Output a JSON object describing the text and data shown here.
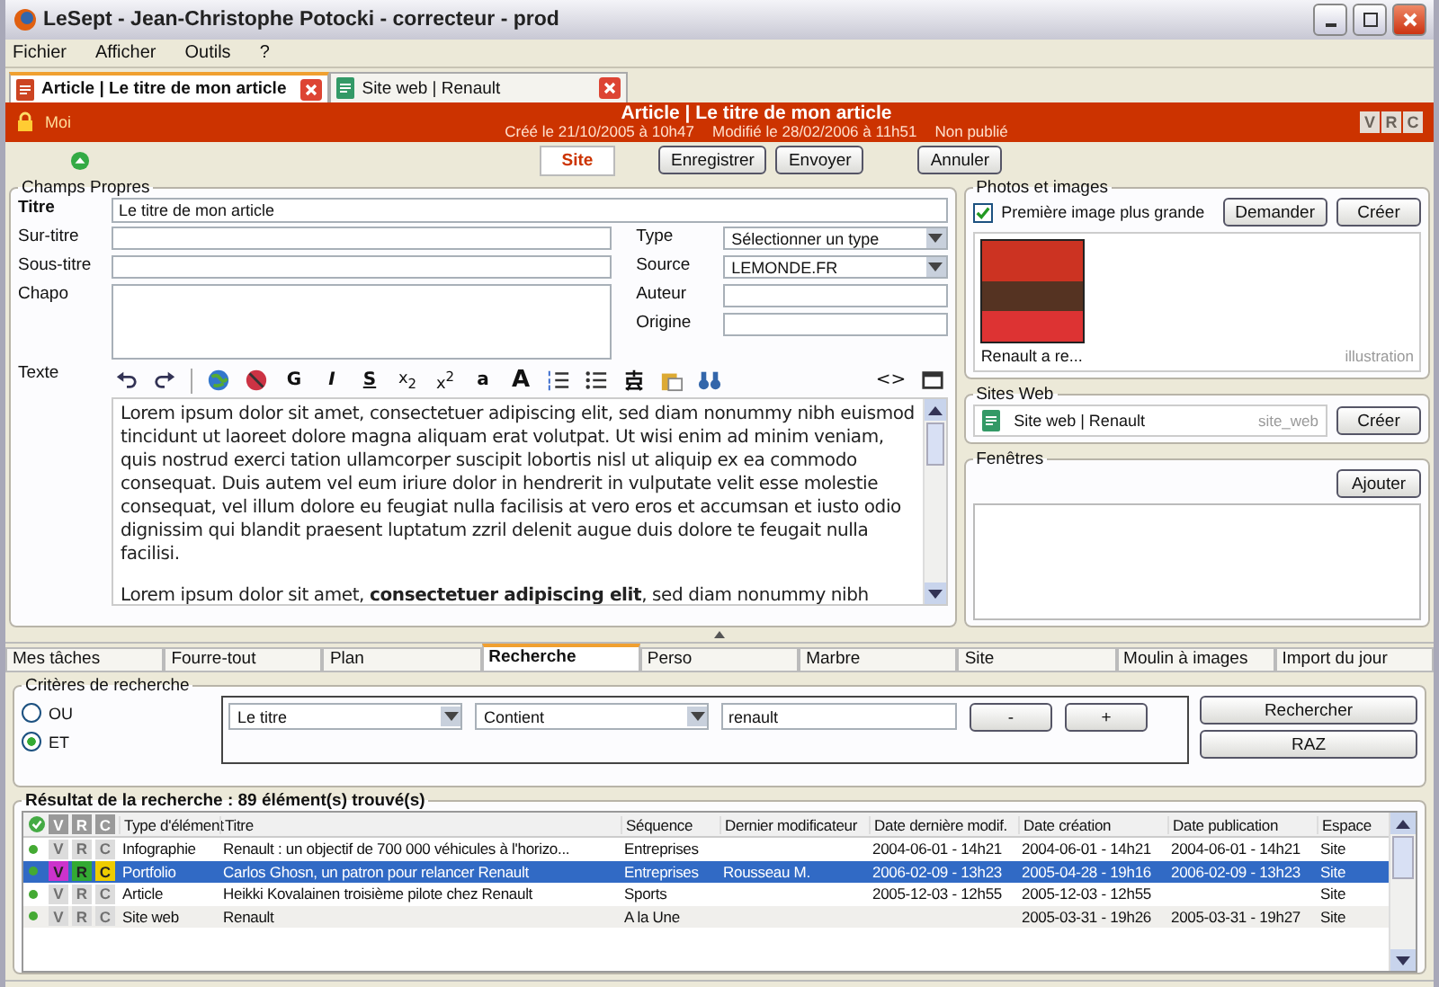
{
  "window": {
    "title": "LeSept - Jean-Christophe Potocki - correcteur - prod"
  },
  "menu": [
    "Fichier",
    "Afficher",
    "Outils",
    "?"
  ],
  "doc_tabs": [
    {
      "label": "Article | Le titre de mon article",
      "selected": true,
      "kind": "article"
    },
    {
      "label": "Site web | Renault",
      "selected": false,
      "kind": "site"
    }
  ],
  "header": {
    "owner": "Moi",
    "title": "Article | Le titre de mon article",
    "created": "Créé le 21/10/2005 à 10h47",
    "modified": "Modifié le 28/02/2006 à 11h51",
    "status": "Non publié",
    "flags": [
      "V",
      "R",
      "C"
    ]
  },
  "actions": {
    "site_tab": {
      "label": "Site",
      "selected": true
    },
    "buttons": [
      "Enregistrer",
      "Envoyer",
      "Annuler"
    ]
  },
  "fields": {
    "legend": "Champs Propres",
    "titre": {
      "label": "Titre",
      "value": "Le titre de mon article"
    },
    "sur_titre": {
      "label": "Sur-titre"
    },
    "sous_titre": {
      "label": "Sous-titre"
    },
    "chapo": {
      "label": "Chapo"
    },
    "type": {
      "label": "Type",
      "value": "Sélectionner un type"
    },
    "source": {
      "label": "Source",
      "value": "LEMONDE.FR"
    },
    "auteur": {
      "label": "Auteur"
    },
    "origine": {
      "label": "Origine"
    },
    "texte": {
      "label": "Texte"
    }
  },
  "editor": {
    "format_buttons": [
      "G",
      "I",
      "S",
      "x$_{2}$",
      "x$^{2}$",
      "a",
      "A"
    ],
    "source_button": "<>",
    "paragraphs": [
      "Lorem ipsum dolor sit amet, consectetuer adipiscing elit, sed diam nonummy nibh euismod tincidunt ut laoreet dolore magna aliquam erat volutpat. Ut wisi enim ad minim veniam, quis nostrud exerci tation ullamcorper suscipit lobortis nisl ut aliquip ex ea commodo consequat. Duis autem vel eum iriure dolor in hendrerit in vulputate velit esse molestie consequat, vel illum dolore eu feugiat nulla facilisis at vero eros et accumsan et iusto odio dignissim qui blandit praesent luptatum zzril delenit augue duis dolore te feugait nulla facilisi.",
      "Lorem ipsum dolor sit amet, **consectetuer adipiscing elit**, sed diam nonummy nibh"
    ]
  },
  "photos": {
    "legend": "Photos et images",
    "checkbox": {
      "label": "Première image plus grande",
      "checked": true
    },
    "buttons": [
      "Demander",
      "Créer"
    ],
    "caption": "Renault a re...",
    "tag": "illustration"
  },
  "sites_web": {
    "legend": "Sites Web",
    "item": "Site web | Renault",
    "tag": "site_web",
    "button": "Créer"
  },
  "fenetres": {
    "legend": "Fenêtres",
    "button": "Ajouter"
  },
  "bottom_tabs": [
    {
      "label": "Mes tâches",
      "selected": false
    },
    {
      "label": "Fourre-tout",
      "selected": false
    },
    {
      "label": "Plan",
      "selected": false
    },
    {
      "label": "Recherche",
      "selected": true
    },
    {
      "label": "Perso",
      "selected": false
    },
    {
      "label": "Marbre",
      "selected": false
    },
    {
      "label": "Site",
      "selected": false
    },
    {
      "label": "Moulin à images",
      "selected": false
    },
    {
      "label": "Import du jour",
      "selected": false
    }
  ],
  "criteria": {
    "legend": "Critères de recherche",
    "radios": [
      {
        "label": "OU",
        "selected": false
      },
      {
        "label": "ET",
        "selected": true
      }
    ],
    "field": "Le titre",
    "operator": "Contient",
    "value": "renault",
    "buttons": [
      "-",
      "+"
    ],
    "search": "Rechercher",
    "reset": "RAZ"
  },
  "results": {
    "title": "Résultat de la recherche : 89 élément(s) trouvé(s)",
    "flag_headers": [
      "V",
      "R",
      "C"
    ],
    "columns": [
      "Type d'élément",
      "Titre",
      "Séquence",
      "Dernier modificateur",
      "Date dernière modif.",
      "Date création",
      "Date publication",
      "Espace"
    ],
    "rows": [
      {
        "selected": false,
        "flags": [
          {
            "letter": "V",
            "on": false
          },
          {
            "letter": "R",
            "on": false
          },
          {
            "letter": "C",
            "on": false
          }
        ],
        "cells": [
          "Infographie",
          "Renault : un objectif de 700 000 véhicules à l'horizo...",
          "Entreprises",
          "",
          "2004-06-01 - 14h21",
          "2004-06-01 - 14h21",
          "2004-06-01 - 14h21",
          "Site"
        ]
      },
      {
        "selected": true,
        "flags": [
          {
            "letter": "V",
            "on": true
          },
          {
            "letter": "R",
            "on": true
          },
          {
            "letter": "C",
            "on": true
          }
        ],
        "cells": [
          "Portfolio",
          "Carlos Ghosn, un patron pour relancer Renault",
          "Entreprises",
          "Rousseau M.",
          "2006-02-09 - 13h23",
          "2005-04-28 - 19h16",
          "2006-02-09 - 13h23",
          "Site"
        ]
      },
      {
        "selected": false,
        "flags": [
          {
            "letter": "V",
            "on": false
          },
          {
            "letter": "R",
            "on": false
          },
          {
            "letter": "C",
            "on": false
          }
        ],
        "cells": [
          "Article",
          "Heikki Kovalainen troisième pilote chez Renault",
          "Sports",
          "",
          "2005-12-03 - 12h55",
          "2005-12-03 - 12h55",
          "",
          "Site"
        ]
      },
      {
        "selected": false,
        "flags": [
          {
            "letter": "V",
            "on": false
          },
          {
            "letter": "R",
            "on": false
          },
          {
            "letter": "C",
            "on": false
          }
        ],
        "cells": [
          "Site web",
          "Renault",
          "A la Une",
          "",
          "",
          "2005-03-31 - 19h26",
          "2005-03-31 - 19h27",
          "Site"
        ]
      }
    ]
  }
}
